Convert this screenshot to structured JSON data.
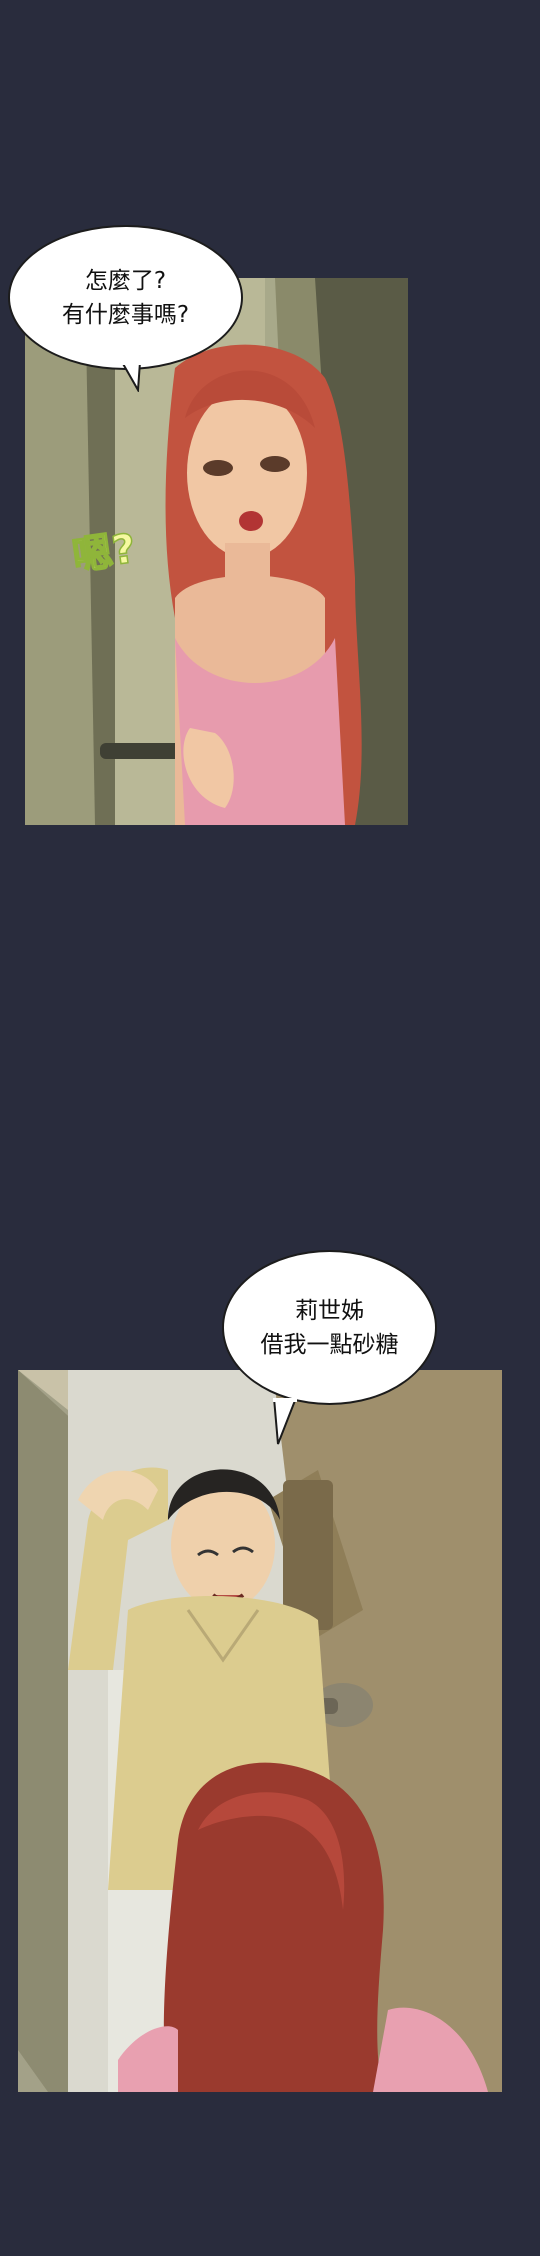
{
  "panels": [
    {
      "bubble_lines": [
        "怎麼了?",
        "有什麼事嗎?"
      ],
      "sfx": "嗯?"
    },
    {
      "bubble_lines": [
        "莉世姊",
        "借我一點砂糖"
      ]
    }
  ],
  "colors": {
    "background": "#292c3d",
    "hair": "#c2533f",
    "shirt": "#e79bad",
    "door": "#8f8e6f",
    "man_shirt": "#dccc8f"
  }
}
